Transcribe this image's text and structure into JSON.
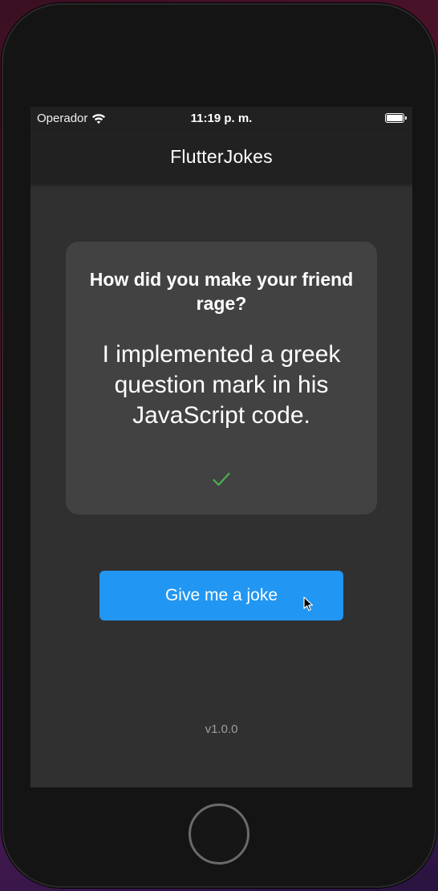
{
  "status_bar": {
    "carrier": "Operador",
    "time": "11:19 p. m.",
    "icons": [
      "wifi-icon",
      "battery-icon"
    ]
  },
  "app_bar": {
    "title": "FlutterJokes"
  },
  "joke": {
    "setup": "How did you make your friend rage?",
    "punchline": "I implemented a greek question mark in his JavaScript code.",
    "status_icon": "check-icon"
  },
  "actions": {
    "give_joke_label": "Give me a joke"
  },
  "footer": {
    "version": "v1.0.0"
  },
  "colors": {
    "accent": "#2196f3",
    "check": "#4caf50",
    "background": "#303030",
    "card": "#424242",
    "app_bar": "#212121"
  }
}
